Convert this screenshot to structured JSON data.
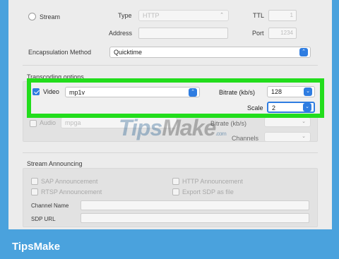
{
  "destination": {
    "stream_label": "Stream",
    "type_label": "Type",
    "type_value": "HTTP",
    "ttl_label": "TTL",
    "ttl_value": "1",
    "address_label": "Address",
    "address_value": "",
    "port_label": "Port",
    "port_value": "1234"
  },
  "encapsulation": {
    "label": "Encapsulation Method",
    "value": "Quicktime"
  },
  "transcoding": {
    "section_title": "Transcoding options",
    "video": {
      "label": "Video",
      "codec": "mp1v",
      "checked": true,
      "bitrate_label": "Bitrate (kb/s)",
      "bitrate": "128",
      "scale_label": "Scale",
      "scale": "2"
    },
    "audio": {
      "label": "Audio",
      "codec": "mpga",
      "checked": false,
      "bitrate_label": "Bitrate (kb/s)",
      "channels_label": "Channels"
    }
  },
  "announcing": {
    "section_title": "Stream Announcing",
    "sap_label": "SAP Announcement",
    "rtsp_label": "RTSP Announcement",
    "http_label": "HTTP Announcement",
    "export_sdp_label": "Export SDP as file",
    "channel_name_label": "Channel Name",
    "sdp_url_label": "SDP URL"
  },
  "watermark": {
    "tips": "Tips",
    "make": "Make",
    "suffix": ".com"
  },
  "brand": "TipsMake",
  "colors": {
    "accent": "#2f7de1",
    "highlight": "#22dd1c",
    "background": "#4aa2dd"
  }
}
